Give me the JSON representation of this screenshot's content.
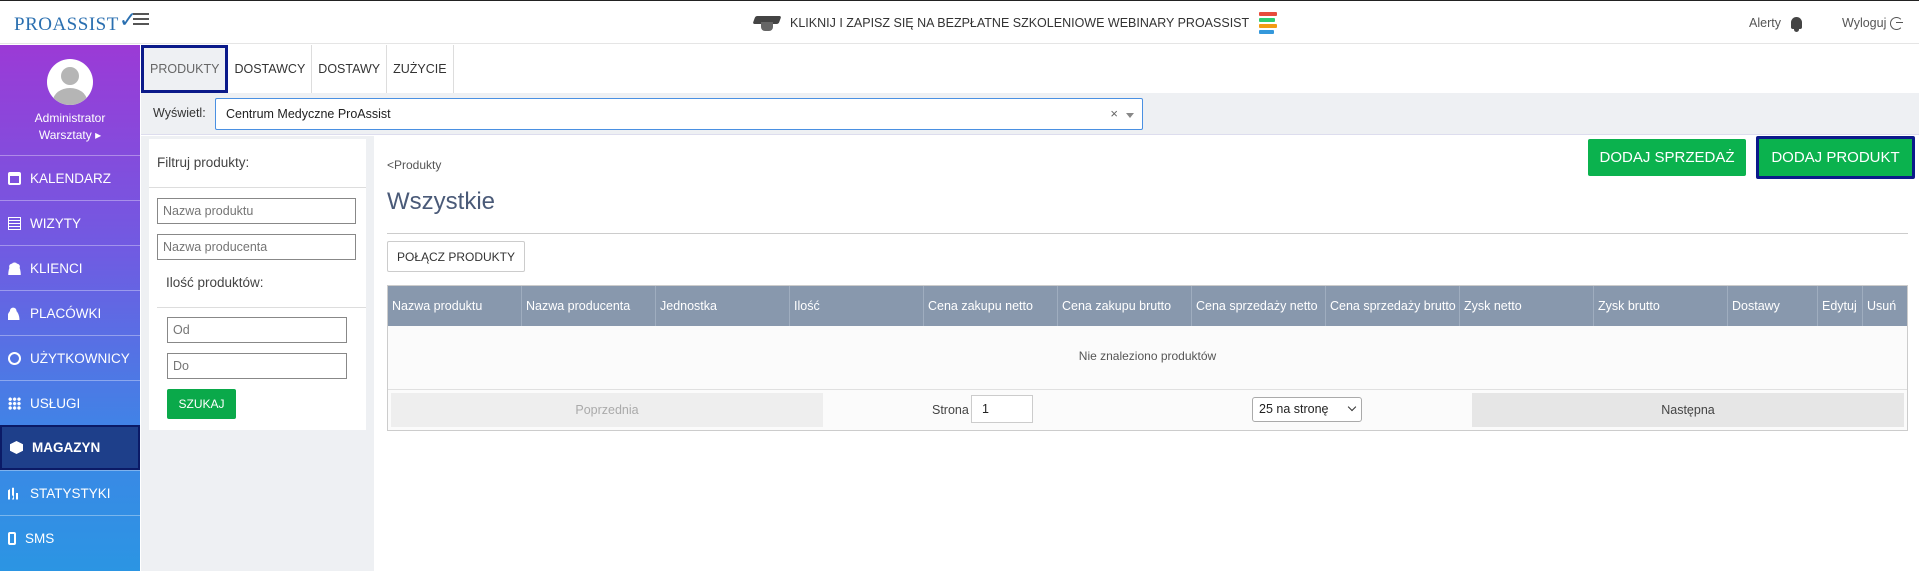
{
  "header": {
    "logo": "PROASSIST",
    "banner": "KLIKNIJ I ZAPISZ SIĘ NA BEZPŁATNE SZKOLENIOWE WEBINARY PROASSIST",
    "alerts": "Alerty",
    "logout": "Wyloguj"
  },
  "sidebar": {
    "user_name": "Administrator",
    "user_place": "Warsztaty ▸",
    "items": [
      {
        "label": "KALENDARZ",
        "icon": "calendar-icon"
      },
      {
        "label": "WIZYTY",
        "icon": "list-icon"
      },
      {
        "label": "KLIENCI",
        "icon": "users-icon"
      },
      {
        "label": "PLACÓWKI",
        "icon": "add-user-icon"
      },
      {
        "label": "UŻYTKOWNICY",
        "icon": "user-circle-icon"
      },
      {
        "label": "USŁUGI",
        "icon": "grid-icon"
      },
      {
        "label": "MAGAZYN",
        "icon": "box-icon"
      },
      {
        "label": "STATYSTYKI",
        "icon": "bar-chart-icon"
      },
      {
        "label": "SMS",
        "icon": "phone-icon"
      }
    ]
  },
  "tabs": [
    "PRODUKTY",
    "DOSTAWCY",
    "DOSTAWY",
    "ZUŻYCIE"
  ],
  "filterbar": {
    "label": "Wyświetl:",
    "selected": "Centrum Medyczne ProAssist",
    "clear": "×"
  },
  "filter_panel": {
    "title": "Filtruj produkty:",
    "product_name_placeholder": "Nazwa produktu",
    "producer_placeholder": "Nazwa producenta",
    "quantity_title": "Ilość produktów:",
    "from_placeholder": "Od",
    "to_placeholder": "Do",
    "search_button": "SZUKAJ"
  },
  "main": {
    "breadcrumb": "<Produkty",
    "title": "Wszystkie",
    "add_sale_button": "DODAJ SPRZEDAŻ",
    "add_product_button": "DODAJ PRODUKT",
    "merge_button": "POŁĄCZ PRODUKTY"
  },
  "table": {
    "columns": [
      "Nazwa produktu",
      "Nazwa producenta",
      "Jednostka",
      "Ilość",
      "Cena zakupu netto",
      "Cena zakupu brutto",
      "Cena sprzedaży netto",
      "Cena sprzedaży brutto",
      "Zysk netto",
      "Zysk brutto",
      "Dostawy",
      "Edytuj",
      "Usuń"
    ],
    "empty_message": "Nie znaleziono produktów"
  },
  "pager": {
    "prev": "Poprzednia",
    "page_label": "Strona",
    "page_value": "1",
    "per_page": "25 na stronę",
    "next": "Następna"
  }
}
